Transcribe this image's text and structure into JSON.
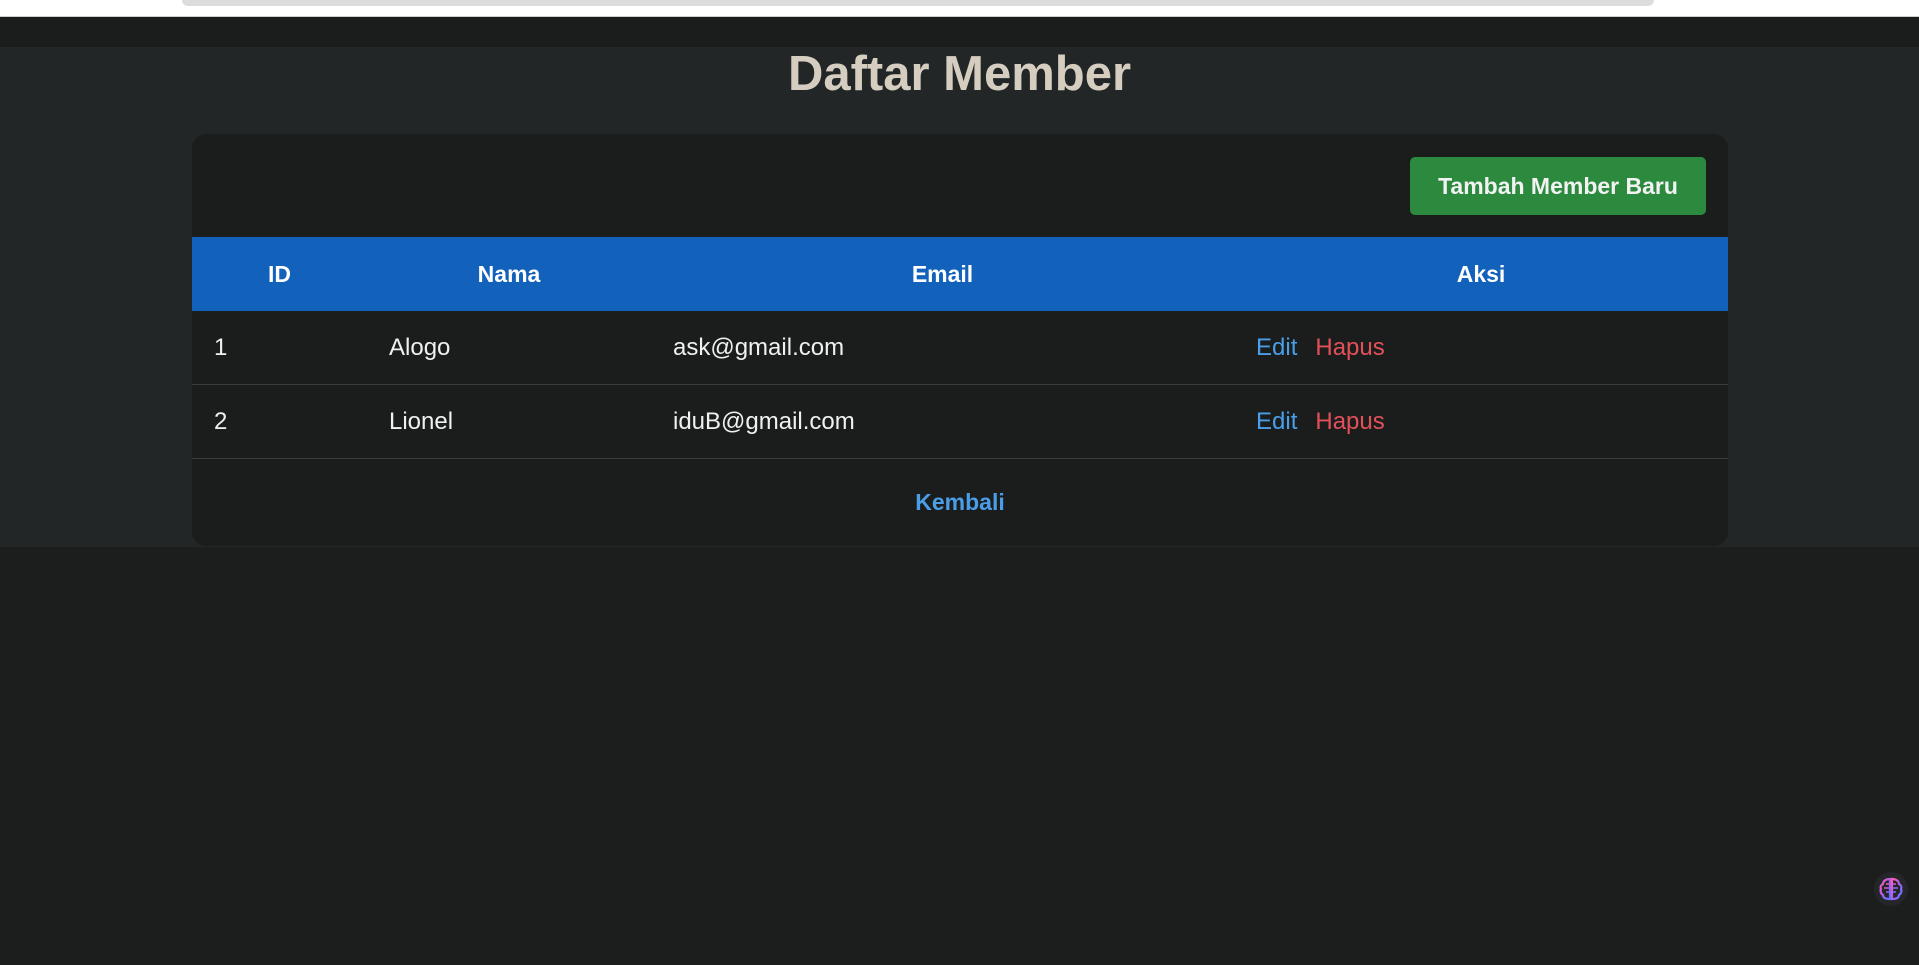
{
  "page": {
    "title": "Daftar Member"
  },
  "toolbar": {
    "add_label": "Tambah Member Baru"
  },
  "table": {
    "headers": [
      "ID",
      "Nama",
      "Email",
      "Aksi"
    ],
    "rows": [
      {
        "id": "1",
        "nama": "Alogo",
        "email": "ask@gmail.com",
        "edit": "Edit",
        "hapus": "Hapus"
      },
      {
        "id": "2",
        "nama": "Lionel",
        "email": "iduB@gmail.com",
        "edit": "Edit",
        "hapus": "Hapus"
      }
    ]
  },
  "footer": {
    "back_label": "Kembali"
  },
  "icons": {
    "extension": "brain-icon"
  },
  "colors": {
    "background": "#1c1e1e",
    "title": "#d5cdbf",
    "header": "#1261bb",
    "add_button": "#2b8a3e",
    "link": "#4a9ee8",
    "danger": "#e3505a"
  }
}
